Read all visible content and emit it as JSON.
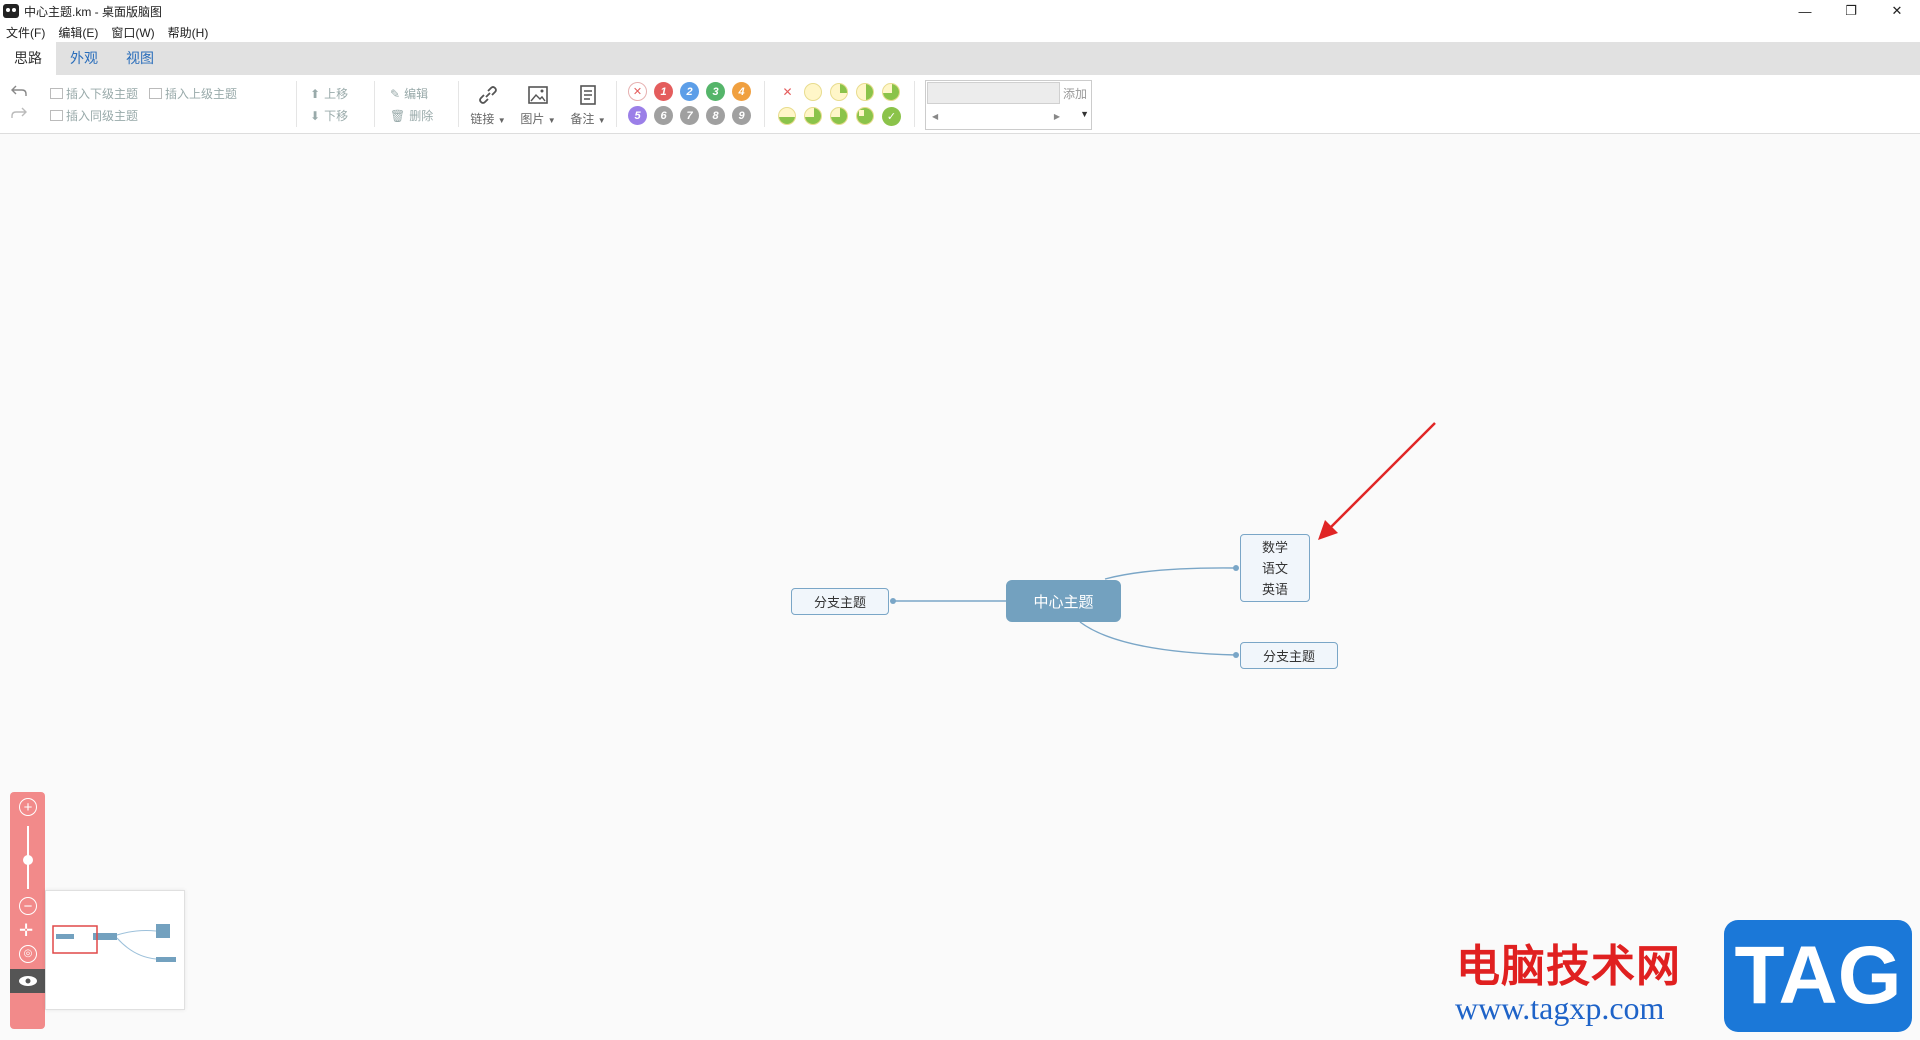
{
  "window": {
    "title": "中心主题.km - 桌面版脑图",
    "minimize": "—",
    "restore": "❐",
    "close": "✕"
  },
  "menu": [
    "文件(F)",
    "编辑(E)",
    "窗口(W)",
    "帮助(H)"
  ],
  "tabs": [
    "思路",
    "外观",
    "视图"
  ],
  "active_tab": "思路",
  "toolbar": {
    "insert_child": "插入下级主题",
    "insert_parent": "插入上级主题",
    "insert_sibling": "插入同级主题",
    "move_up": "上移",
    "move_down": "下移",
    "edit": "编辑",
    "delete": "删除",
    "link": "链接",
    "image": "图片",
    "note": "备注",
    "priorities_row1": [
      "✕",
      "1",
      "2",
      "3",
      "4"
    ],
    "priorities_row2": [
      "5",
      "6",
      "7",
      "8",
      "9"
    ],
    "resource_add": "添加"
  },
  "colors": {
    "priority": [
      "#f3a3a3",
      "#e45d5d",
      "#5c9ee8",
      "#55b56a",
      "#f0a040",
      "#9b7fe8",
      "#a0a0a0",
      "#a0a0a0",
      "#a0a0a0",
      "#a0a0a0"
    ],
    "root_node": "#73a1bf",
    "accent": "#2a6ebb",
    "zoom_bar": "#f28a8a"
  },
  "mindmap": {
    "root": "中心主题",
    "left_branch": "分支主题",
    "right_top_lines": [
      "数学",
      "语文",
      "英语"
    ],
    "right_bottom": "分支主题"
  },
  "watermark": {
    "site_name": "电脑技术网",
    "url": "www.tagxp.com",
    "tag": "TAG"
  }
}
